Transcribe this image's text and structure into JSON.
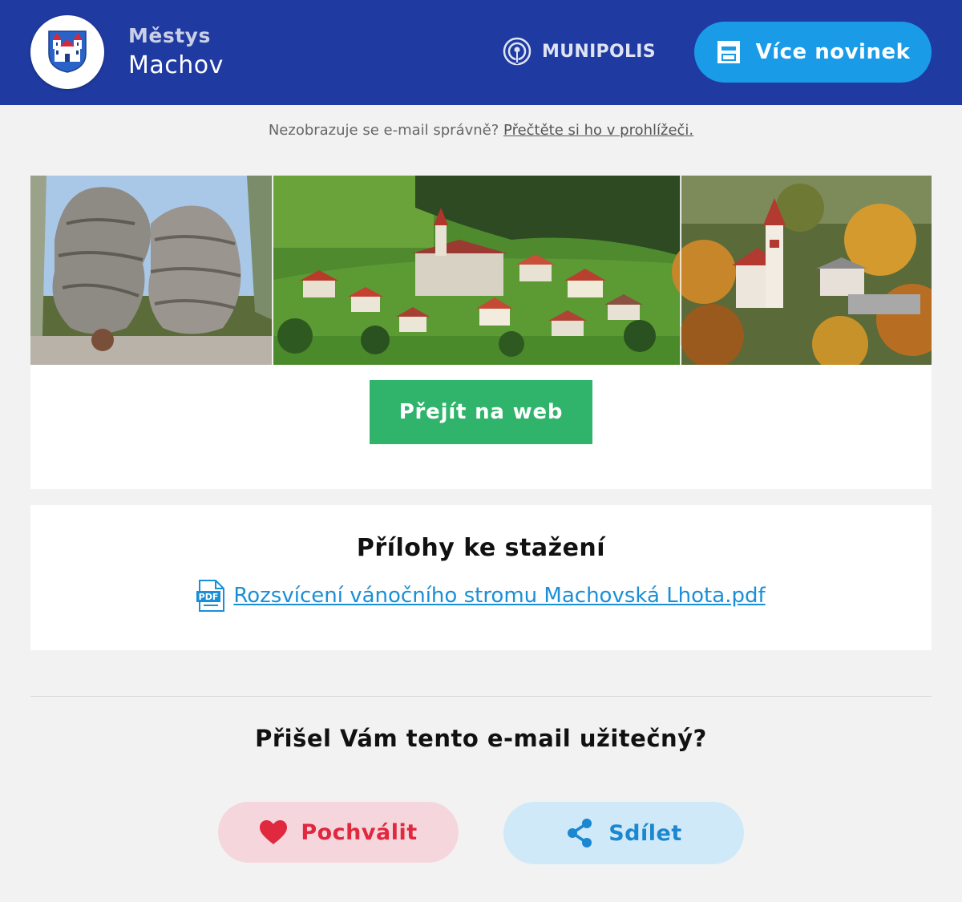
{
  "header": {
    "municipality_type": "Městys",
    "municipality_name": "Machov",
    "brand": "MUNIPOLIS",
    "more_news_label": "Více novinek",
    "bg_color": "#1f3aa0",
    "accent_color": "#1a9be8"
  },
  "preheader": {
    "text": "Nezobrazuje se e-mail správně?",
    "link_label": "Přečtěte si ho v prohlížeči."
  },
  "hero": {
    "button_label": "Přejít na web",
    "button_color": "#30b46c"
  },
  "attachments": {
    "title": "Přílohy ke stažení",
    "items": [
      {
        "icon": "pdf-file-icon",
        "label": "Rozsvícení vánočního stromu Machovská Lhota.pdf"
      }
    ]
  },
  "feedback": {
    "question": "Přišel Vám tento e-mail užitečný?",
    "praise_label": "Pochválit",
    "share_label": "Sdílet",
    "praise_color": "#e0283f",
    "share_color": "#1a87d0"
  }
}
